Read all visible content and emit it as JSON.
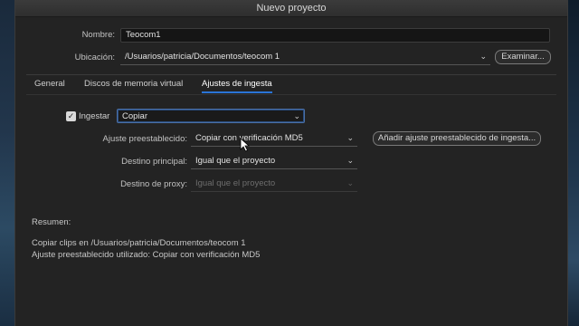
{
  "window": {
    "title": "Nuevo proyecto"
  },
  "form": {
    "name_label": "Nombre:",
    "name_value": "Teocom1",
    "location_label": "Ubicación:",
    "location_value": "/Usuarios/patricia/Documentos/teocom 1",
    "browse_button": "Examinar..."
  },
  "tabs": [
    {
      "label": "General"
    },
    {
      "label": "Discos de memoria virtual"
    },
    {
      "label": "Ajustes de ingesta"
    }
  ],
  "ingest": {
    "ingest_label": "Ingestar",
    "ingest_checked": true,
    "ingest_mode": "Copiar",
    "preset_label": "Ajuste preestablecido:",
    "preset_value": "Copiar con verificación MD5",
    "add_preset_button": "Añadir ajuste preestablecido de ingesta...",
    "primary_dest_label": "Destino principal:",
    "primary_dest_value": "Igual que el proyecto",
    "proxy_dest_label": "Destino de proxy:",
    "proxy_dest_value": "Igual que el proyecto"
  },
  "summary": {
    "title": "Resumen:",
    "line1": "Copiar clips en /Usuarios/patricia/Documentos/teocom 1",
    "line2": "Ajuste preestablecido utilizado: Copiar con verificación MD5"
  },
  "icons": {
    "checkbox": "checkmark-icon",
    "dropdown": "chevron-down-icon",
    "pointer": "mouse-pointer-icon"
  },
  "colors": {
    "accent": "#2a74d6",
    "dialog_bg": "#232323"
  }
}
